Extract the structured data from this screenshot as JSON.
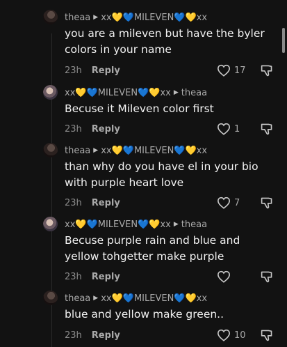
{
  "comments": [
    {
      "author": "theaa",
      "reply_to": "xx💛💙MILEVEN💙💛xx",
      "text": "you are a mileven but have the byler colors in your name",
      "time": "23h",
      "reply_label": "Reply",
      "likes": "17"
    },
    {
      "author": "xx💛💙MILEVEN💙💛xx",
      "reply_to": "theaa",
      "text": "Becuse it Mileven color first",
      "time": "23h",
      "reply_label": "Reply",
      "likes": "1"
    },
    {
      "author": "theaa",
      "reply_to": "xx💛💙MILEVEN💙💛xx",
      "text": "than why do you have el in your bio with purple heart love",
      "time": "23h",
      "reply_label": "Reply",
      "likes": "7"
    },
    {
      "author": "xx💛💙MILEVEN💙💛xx",
      "reply_to": "theaa",
      "text": "Becuse purple rain and blue and yellow tohgetter make purple",
      "time": "23h",
      "reply_label": "Reply",
      "likes": ""
    },
    {
      "author": "theaa",
      "reply_to": "xx💛💙MILEVEN💙💛xx",
      "text": "blue and yellow make green..",
      "time": "23h",
      "reply_label": "Reply",
      "likes": "10"
    }
  ],
  "icons": {
    "like": "heart-outline-icon",
    "dislike": "thumbs-down-outline-icon",
    "reply_arrow": "caret-right-icon"
  },
  "colors": {
    "background": "#121212",
    "text": "#f2f2f2",
    "meta": "#8a8a8a"
  }
}
